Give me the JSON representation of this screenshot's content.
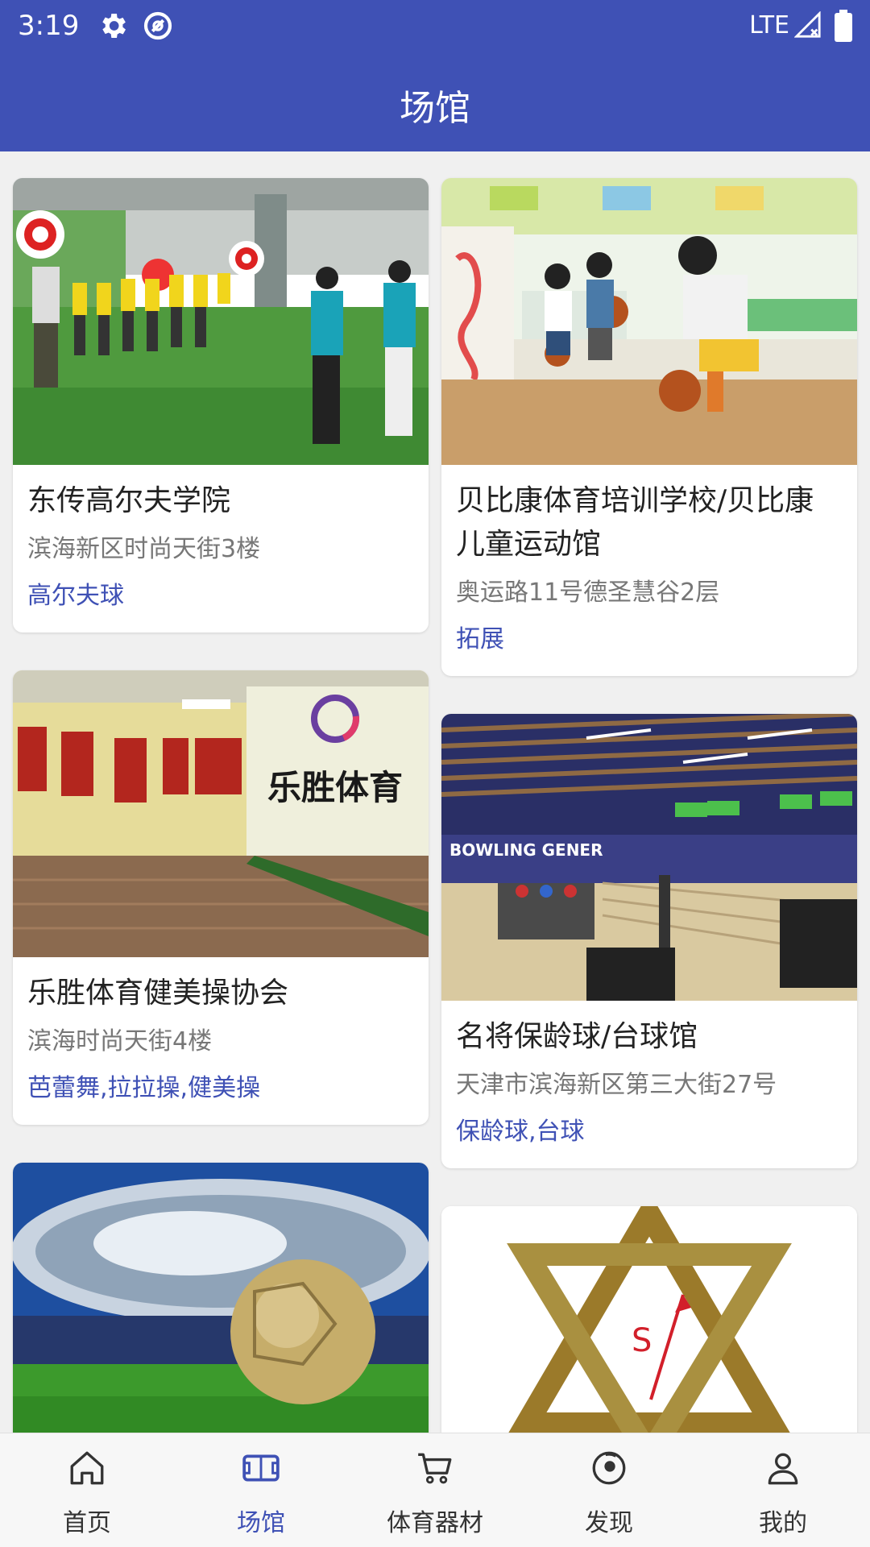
{
  "status_bar": {
    "time": "3:19",
    "network": "LTE"
  },
  "app_bar": {
    "title": "场馆"
  },
  "venues": [
    {
      "name": "东传高尔夫学院",
      "address": "滨海新区时尚天街3楼",
      "tags": "高尔夫球"
    },
    {
      "name": "贝比康体育培训学校/贝比康儿童运动馆",
      "address": "奥运路11号德圣慧谷2层",
      "tags": "拓展"
    },
    {
      "name": "乐胜体育健美操协会",
      "address": "滨海时尚天街4楼",
      "tags": "芭蕾舞,拉拉操,健美操",
      "image_text": "乐胜体育"
    },
    {
      "name": "名将保龄球/台球馆",
      "address": "天津市滨海新区第三大街27号",
      "tags": "保龄球,台球",
      "image_text": "BOWLING GENER"
    }
  ],
  "bottom_nav": {
    "items": [
      {
        "label": "首页",
        "icon": "home-icon"
      },
      {
        "label": "场馆",
        "icon": "venue-icon",
        "active": true
      },
      {
        "label": "体育器材",
        "icon": "cart-icon"
      },
      {
        "label": "发现",
        "icon": "discover-icon"
      },
      {
        "label": "我的",
        "icon": "profile-icon"
      }
    ]
  },
  "colors": {
    "primary": "#3f51b5",
    "background": "#f0f0f0"
  }
}
